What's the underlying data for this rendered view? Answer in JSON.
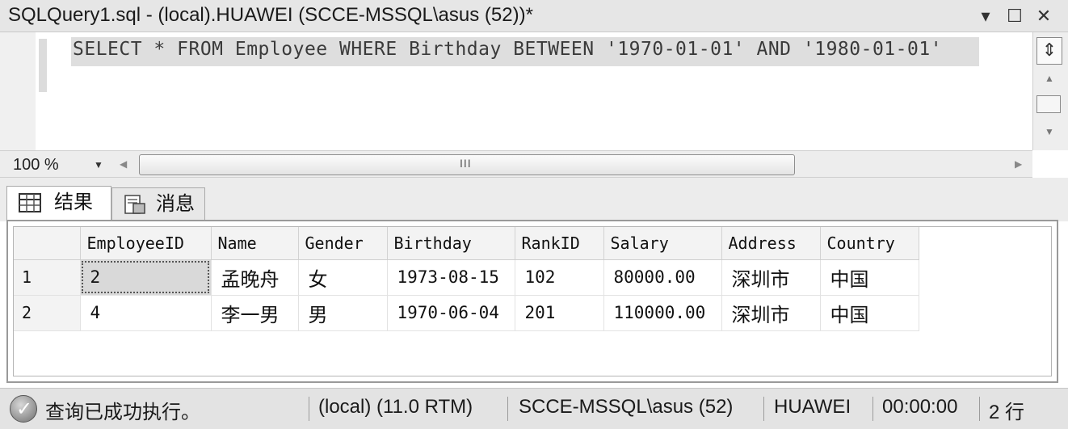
{
  "window": {
    "title": "SQLQuery1.sql - (local).HUAWEI (SCCE-MSSQL\\asus (52))*",
    "dropdown_glyph": "▾",
    "maximize_glyph": "☐",
    "close_glyph": "✕"
  },
  "editor": {
    "query": "SELECT * FROM Employee WHERE Birthday BETWEEN '1970-01-01' AND '1980-01-01'",
    "split_glyph": "⇕",
    "scroll_up_glyph": "▲",
    "scroll_down_glyph": "▼"
  },
  "zoom": {
    "value": "100 %",
    "arrow": "▼"
  },
  "hscroll": {
    "left_glyph": "◀",
    "grip": "III",
    "right_glyph": "▶"
  },
  "tabs": [
    {
      "label": "结果",
      "icon": "grid-icon",
      "active": true
    },
    {
      "label": "消息",
      "icon": "message-icon",
      "active": false
    }
  ],
  "results": {
    "columns": [
      "EmployeeID",
      "Name",
      "Gender",
      "Birthday",
      "RankID",
      "Salary",
      "Address",
      "Country"
    ],
    "rows": [
      {
        "num": "1",
        "cells": [
          "2",
          "孟晚舟",
          "女",
          "1973-08-15",
          "102",
          "80000.00",
          "深圳市",
          "中国"
        ]
      },
      {
        "num": "2",
        "cells": [
          "4",
          "李一男",
          "男",
          "1970-06-04",
          "201",
          "110000.00",
          "深圳市",
          "中国"
        ]
      }
    ]
  },
  "status": {
    "icon": "check-circle-icon",
    "check_glyph": "✓",
    "message": "查询已成功执行。",
    "server": "(local) (11.0 RTM)",
    "login": "SCCE-MSSQL\\asus (52)",
    "database": "HUAWEI",
    "elapsed": "00:00:00",
    "rows": "2 行"
  }
}
